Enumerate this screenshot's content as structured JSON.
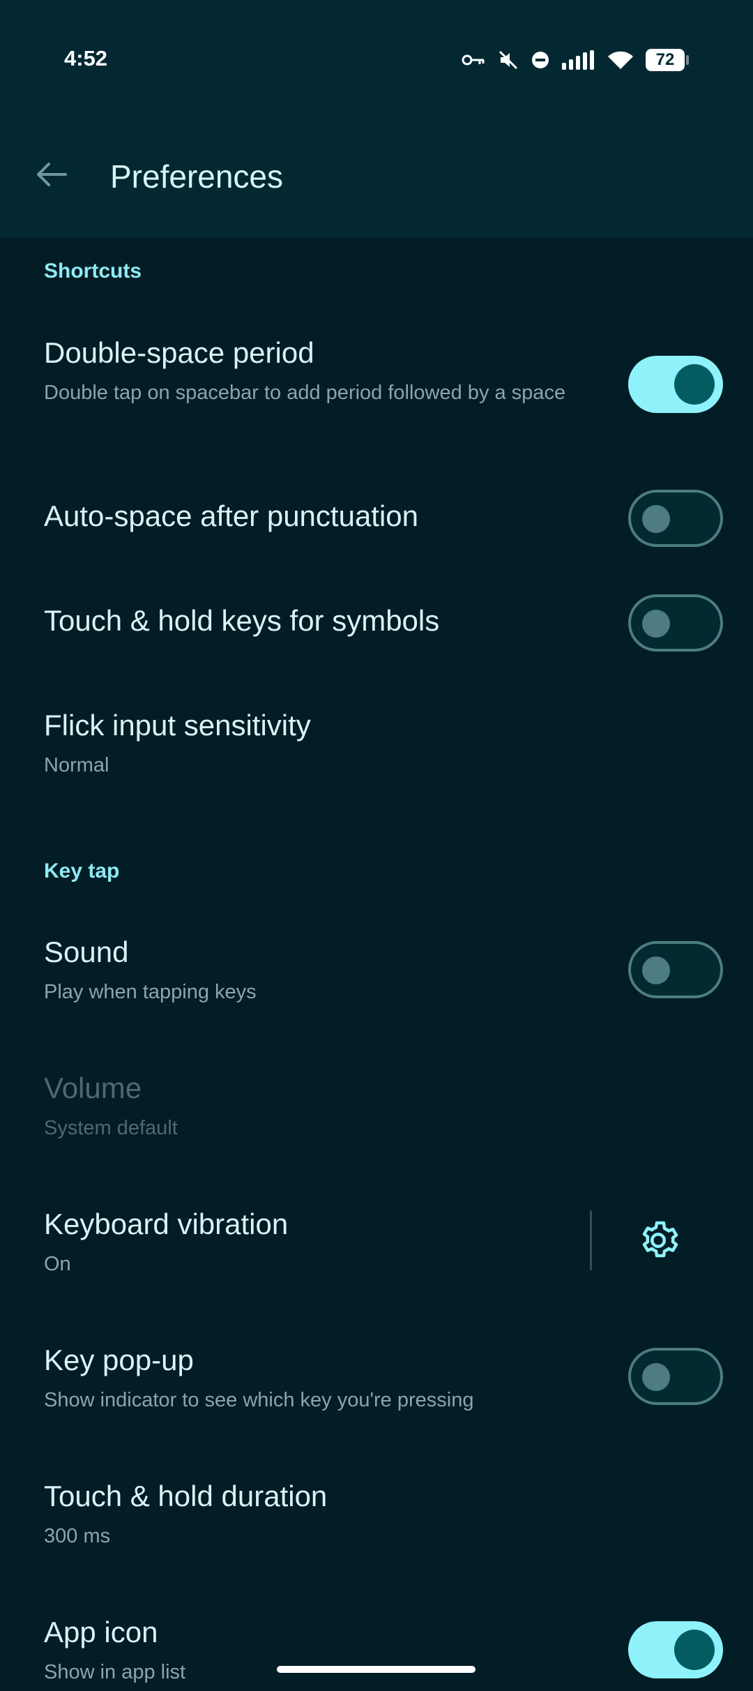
{
  "status": {
    "time": "4:52",
    "battery": "72"
  },
  "app_bar": {
    "title": "Preferences"
  },
  "sections": {
    "shortcuts": "Shortcuts",
    "key_tap": "Key tap"
  },
  "settings": {
    "double_space": {
      "title": "Double-space period",
      "subtitle": "Double tap on spacebar to add period followed by a space",
      "enabled": true
    },
    "auto_space": {
      "title": "Auto-space after punctuation",
      "enabled": false
    },
    "touch_hold_symbols": {
      "title": "Touch & hold keys for symbols",
      "enabled": false
    },
    "flick": {
      "title": "Flick input sensitivity",
      "subtitle": "Normal"
    },
    "sound": {
      "title": "Sound",
      "subtitle": "Play when tapping keys",
      "enabled": false
    },
    "volume": {
      "title": "Volume",
      "subtitle": "System default"
    },
    "vibration": {
      "title": "Keyboard vibration",
      "subtitle": "On"
    },
    "key_popup": {
      "title": "Key pop-up",
      "subtitle": "Show indicator to see which key you're pressing",
      "enabled": false
    },
    "hold_duration": {
      "title": "Touch & hold duration",
      "subtitle": "300 ms"
    },
    "app_icon": {
      "title": "App icon",
      "subtitle": "Show in app list",
      "enabled": true
    }
  },
  "colors": {
    "background": "#021d25",
    "app_bar": "#032831",
    "accent": "#8ff2fb",
    "section_header": "#8fe9f3"
  }
}
